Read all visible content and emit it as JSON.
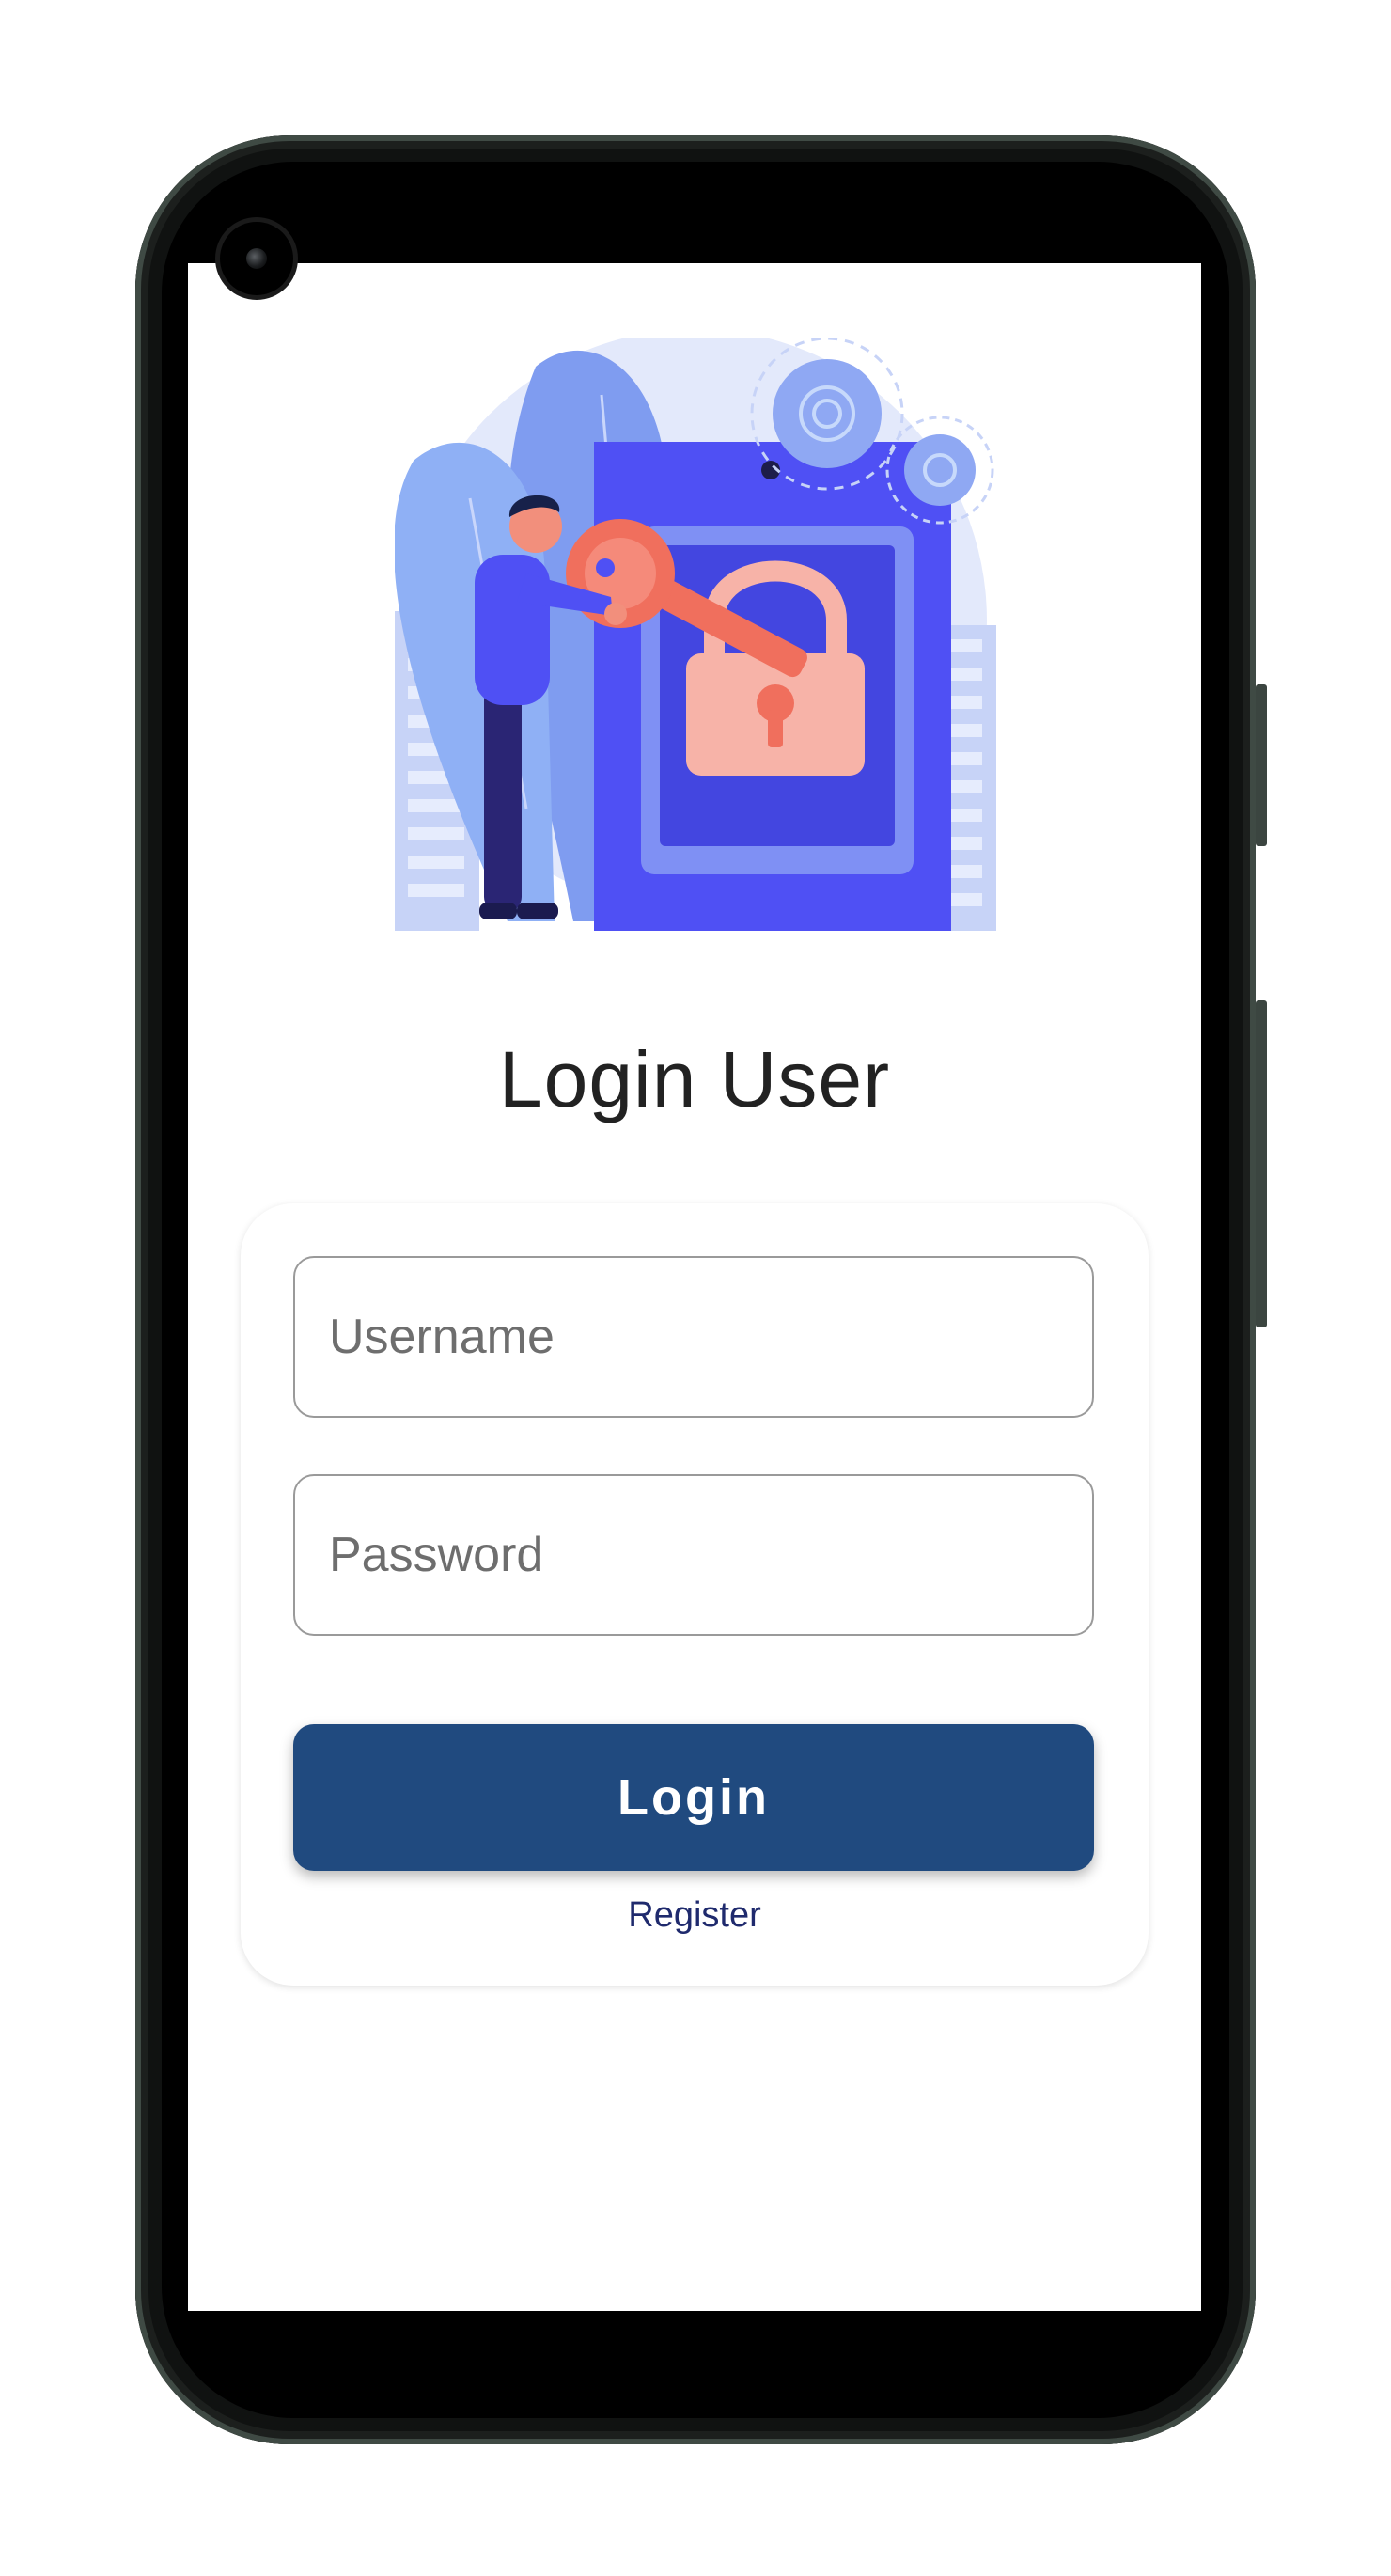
{
  "login_page": {
    "title": "Login User",
    "username_placeholder": "Username",
    "password_placeholder": "Password",
    "login_label": "Login",
    "register_label": "Register"
  },
  "colors": {
    "primary_button": "#204a7f",
    "register_link": "#1f2a6d",
    "illustration_indigo": "#4f50f4",
    "illustration_key": "#f06f5d"
  },
  "illustration": {
    "subject": "person-with-key-unlocking-padlock",
    "icons": [
      "key-icon",
      "padlock-icon",
      "gear-icon"
    ]
  }
}
